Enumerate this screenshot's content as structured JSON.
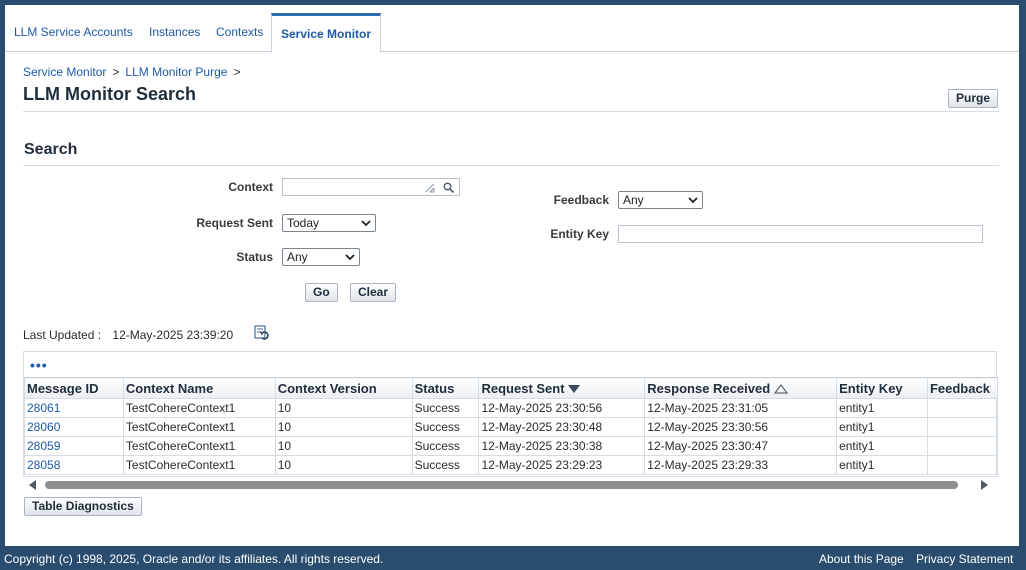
{
  "tabs": [
    {
      "label": "LLM Service Accounts"
    },
    {
      "label": "Instances"
    },
    {
      "label": "Contexts"
    },
    {
      "label": "Service Monitor"
    }
  ],
  "breadcrumb": {
    "items": [
      "Service Monitor",
      "LLM Monitor Purge"
    ],
    "separator": ">"
  },
  "page": {
    "title": "LLM Monitor Search",
    "purge_label": "Purge"
  },
  "search": {
    "title": "Search",
    "context_label": "Context",
    "context_value": "",
    "request_sent_label": "Request Sent",
    "request_sent_value": "Today",
    "status_label": "Status",
    "status_value": "Any",
    "feedback_label": "Feedback",
    "feedback_value": "Any",
    "entity_key_label": "Entity Key",
    "entity_key_value": "",
    "go_label": "Go",
    "clear_label": "Clear"
  },
  "last_updated": {
    "label": "Last Updated :",
    "value": "12-May-2025 23:39:20"
  },
  "table": {
    "more_label": "•••",
    "columns": [
      "Message ID",
      "Context Name",
      "Context Version",
      "Status",
      "Request Sent",
      "Response Received",
      "Entity Key",
      "Feedback"
    ],
    "rows": [
      [
        "28061",
        "TestCohereContext1",
        "10",
        "Success",
        "12-May-2025 23:30:56",
        "12-May-2025 23:31:05",
        "entity1",
        ""
      ],
      [
        "28060",
        "TestCohereContext1",
        "10",
        "Success",
        "12-May-2025 23:30:48",
        "12-May-2025 23:30:56",
        "entity1",
        ""
      ],
      [
        "28059",
        "TestCohereContext1",
        "10",
        "Success",
        "12-May-2025 23:30:38",
        "12-May-2025 23:30:47",
        "entity1",
        ""
      ],
      [
        "28058",
        "TestCohereContext1",
        "10",
        "Success",
        "12-May-2025 23:29:23",
        "12-May-2025 23:29:33",
        "entity1",
        ""
      ]
    ],
    "diagnostics_label": "Table Diagnostics"
  },
  "footer": {
    "copyright": "Copyright (c) 1998, 2025, Oracle and/or its affiliates. All rights reserved.",
    "about": "About this Page",
    "privacy": "Privacy Statement"
  },
  "colors": {
    "brand": "#2a4c6e",
    "link": "#1e5aa8",
    "active_tab_border": "#2c6eab"
  },
  "icons": [
    "search-icon",
    "resize-icon",
    "refresh-icon",
    "sort-descending-icon",
    "sort-ascending-icon",
    "scroll-left-icon",
    "scroll-right-icon"
  ]
}
